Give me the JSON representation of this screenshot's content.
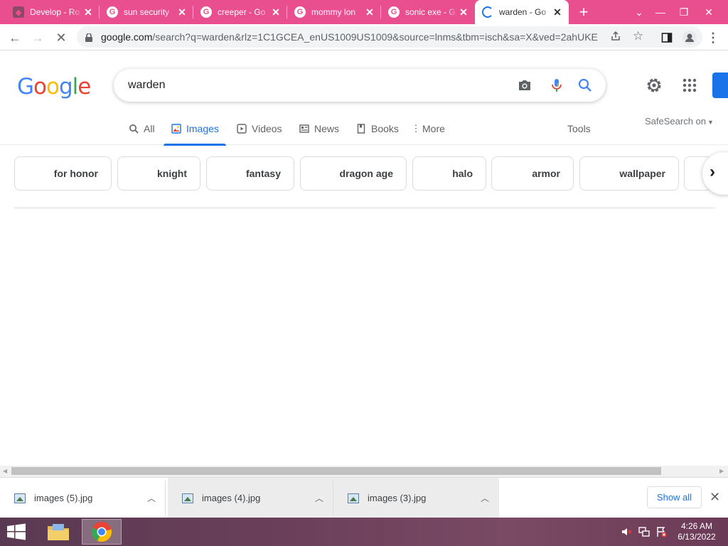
{
  "browser": {
    "tabs": [
      {
        "title": "Develop - Ro",
        "favicon": "roblox-studio-icon",
        "active": false
      },
      {
        "title": "sun security",
        "favicon": "google-g-icon",
        "active": false
      },
      {
        "title": "creeper - Go",
        "favicon": "google-g-icon",
        "active": false
      },
      {
        "title": "mommy lon",
        "favicon": "google-g-icon",
        "active": false
      },
      {
        "title": "sonic exe - G",
        "favicon": "google-g-icon",
        "active": false
      },
      {
        "title": "warden - Go",
        "favicon": "loading-spinner-icon",
        "active": true
      }
    ],
    "url_host": "google.com",
    "url_path": "/search?q=warden&rlz=1C1GCEA_enUS1009US1009&source=lnms&tbm=isch&sa=X&ved=2ahUKE...",
    "tab_strip_color": "#e94e8f"
  },
  "google": {
    "logo_letters": [
      "G",
      "o",
      "o",
      "g",
      "l",
      "e"
    ],
    "logo_colors": [
      "#4285f4",
      "#ea4335",
      "#fbbc05",
      "#4285f4",
      "#34a853",
      "#ea4335"
    ],
    "query": "warden",
    "nav_tabs": [
      {
        "label": "All",
        "icon": "search-icon",
        "selected": false
      },
      {
        "label": "Images",
        "icon": "image-icon",
        "selected": true
      },
      {
        "label": "Videos",
        "icon": "play-icon",
        "selected": false
      },
      {
        "label": "News",
        "icon": "newspaper-icon",
        "selected": false
      },
      {
        "label": "Books",
        "icon": "book-icon",
        "selected": false
      },
      {
        "label": "More",
        "icon": "more-vert-icon",
        "selected": false
      }
    ],
    "tools_label": "Tools",
    "safesearch_label": "SafeSearch on",
    "chips": [
      "for honor",
      "knight",
      "fantasy",
      "dragon age",
      "halo",
      "armor",
      "wallpaper"
    ],
    "accent": "#1a73e8"
  },
  "downloads": {
    "items": [
      {
        "name": "images (5).jpg"
      },
      {
        "name": "images (4).jpg"
      },
      {
        "name": "images (3).jpg"
      }
    ],
    "show_all_label": "Show all"
  },
  "taskbar": {
    "time": "4:26 AM",
    "date": "6/13/2022"
  }
}
